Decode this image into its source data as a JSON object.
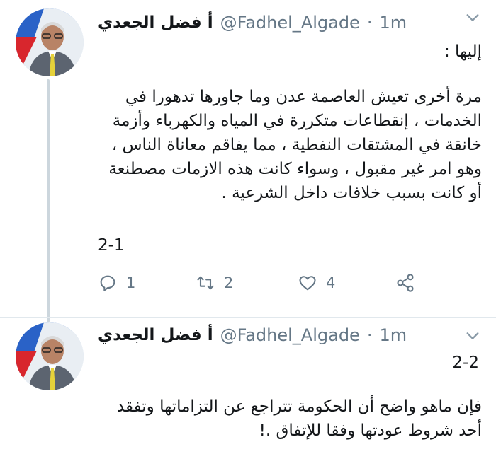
{
  "colors": {
    "text_primary": "#14171a",
    "text_secondary": "#657786",
    "thread_line": "#ccd6dd",
    "divider": "#e1e8ed"
  },
  "tweets": [
    {
      "author_name": "أ فضل الجعدي",
      "handle": "@Fadhel_Algade",
      "separator": "·",
      "time": "1m",
      "greeting": "إليها :",
      "paragraphs": [
        "مرة أخرى تعيش العاصمة عدن وما جاورها تدهورا في الخدمات ، إنقطاعات متكررة في المياه والكهرباء وأزمة خانقة في المشتقات النفطية ، مما يفاقم معاناة الناس ، وهو امر غير مقبول ، وسواء كانت هذه الازمات مصطنعة أو كانت بسبب خلافات داخل الشرعية ."
      ],
      "counter": "2-1",
      "actions": {
        "reply_count": "1",
        "retweet_count": "2",
        "like_count": "4",
        "icons": [
          "reply-icon",
          "retweet-icon",
          "like-icon",
          "share-icon"
        ]
      }
    },
    {
      "author_name": "أ فضل الجعدي",
      "handle": "@Fadhel_Algade",
      "separator": "·",
      "time": "1m",
      "counter": "2-2",
      "paragraphs": [
        "فإن ماهو واضح أن الحكومة تتراجع عن التزاماتها وتفقد أحد شروط عودتها وفقا للإتفاق .!"
      ]
    }
  ]
}
